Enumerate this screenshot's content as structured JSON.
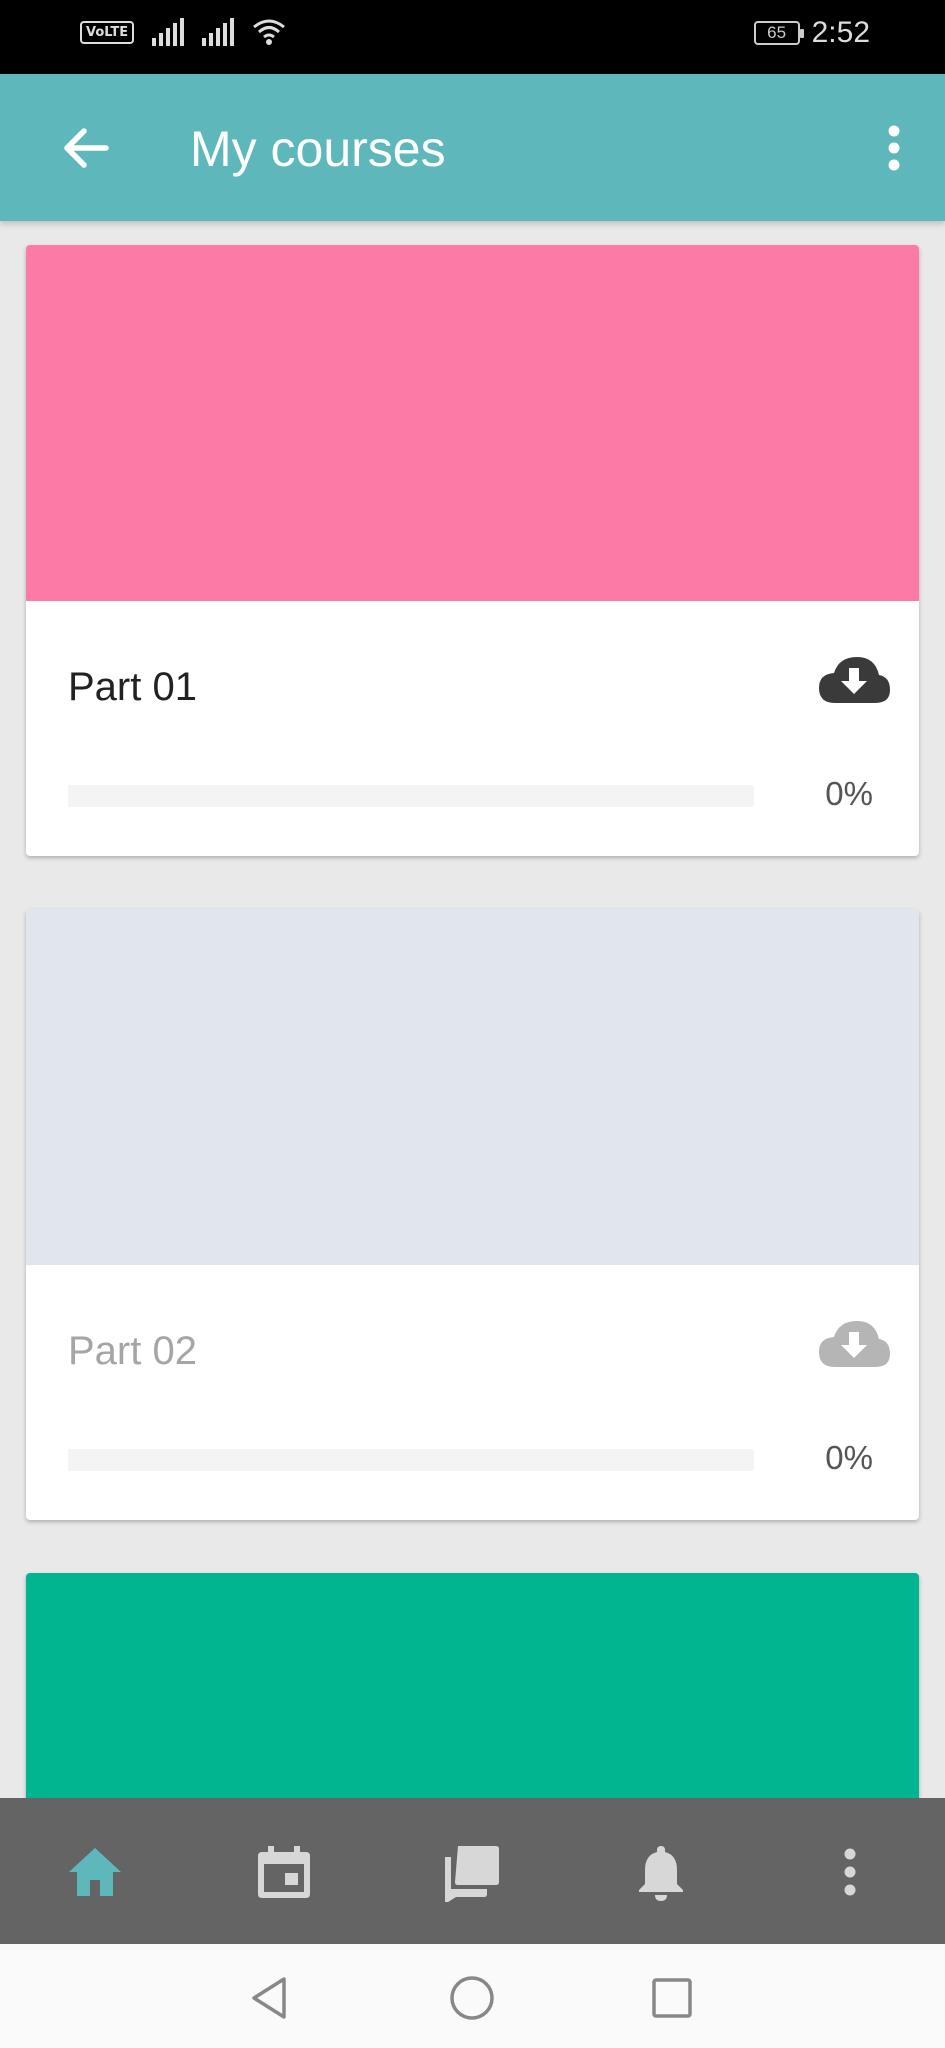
{
  "status_bar": {
    "volte": "VoLTE",
    "battery": "65",
    "time": "2:52"
  },
  "app_bar": {
    "title": "My courses",
    "back_icon": "arrow-back-icon",
    "menu_icon": "more-vert-icon",
    "background": "#5eb8bb"
  },
  "courses": [
    {
      "title": "Part 01",
      "progress_text": "0%",
      "progress": 0,
      "banner_color": "#fc7aa6",
      "download_icon": "cloud-download-icon",
      "enabled": true
    },
    {
      "title": "Part 02",
      "progress_text": "0%",
      "progress": 0,
      "banner_color": "#e1e6ec",
      "download_icon": "cloud-download-icon",
      "enabled": false
    },
    {
      "banner_color": "#00b58f"
    }
  ],
  "bottom_nav": {
    "items": [
      {
        "icon": "home-icon",
        "active": true
      },
      {
        "icon": "calendar-icon",
        "active": false
      },
      {
        "icon": "forum-icon",
        "active": false
      },
      {
        "icon": "bell-icon",
        "active": false
      },
      {
        "icon": "more-vert-icon",
        "active": false
      }
    ],
    "active_color": "#5eb8bb",
    "inactive_color": "#d7d7d7"
  },
  "system_nav": {
    "buttons": [
      "back-triangle-icon",
      "home-circle-icon",
      "recents-square-icon"
    ]
  }
}
